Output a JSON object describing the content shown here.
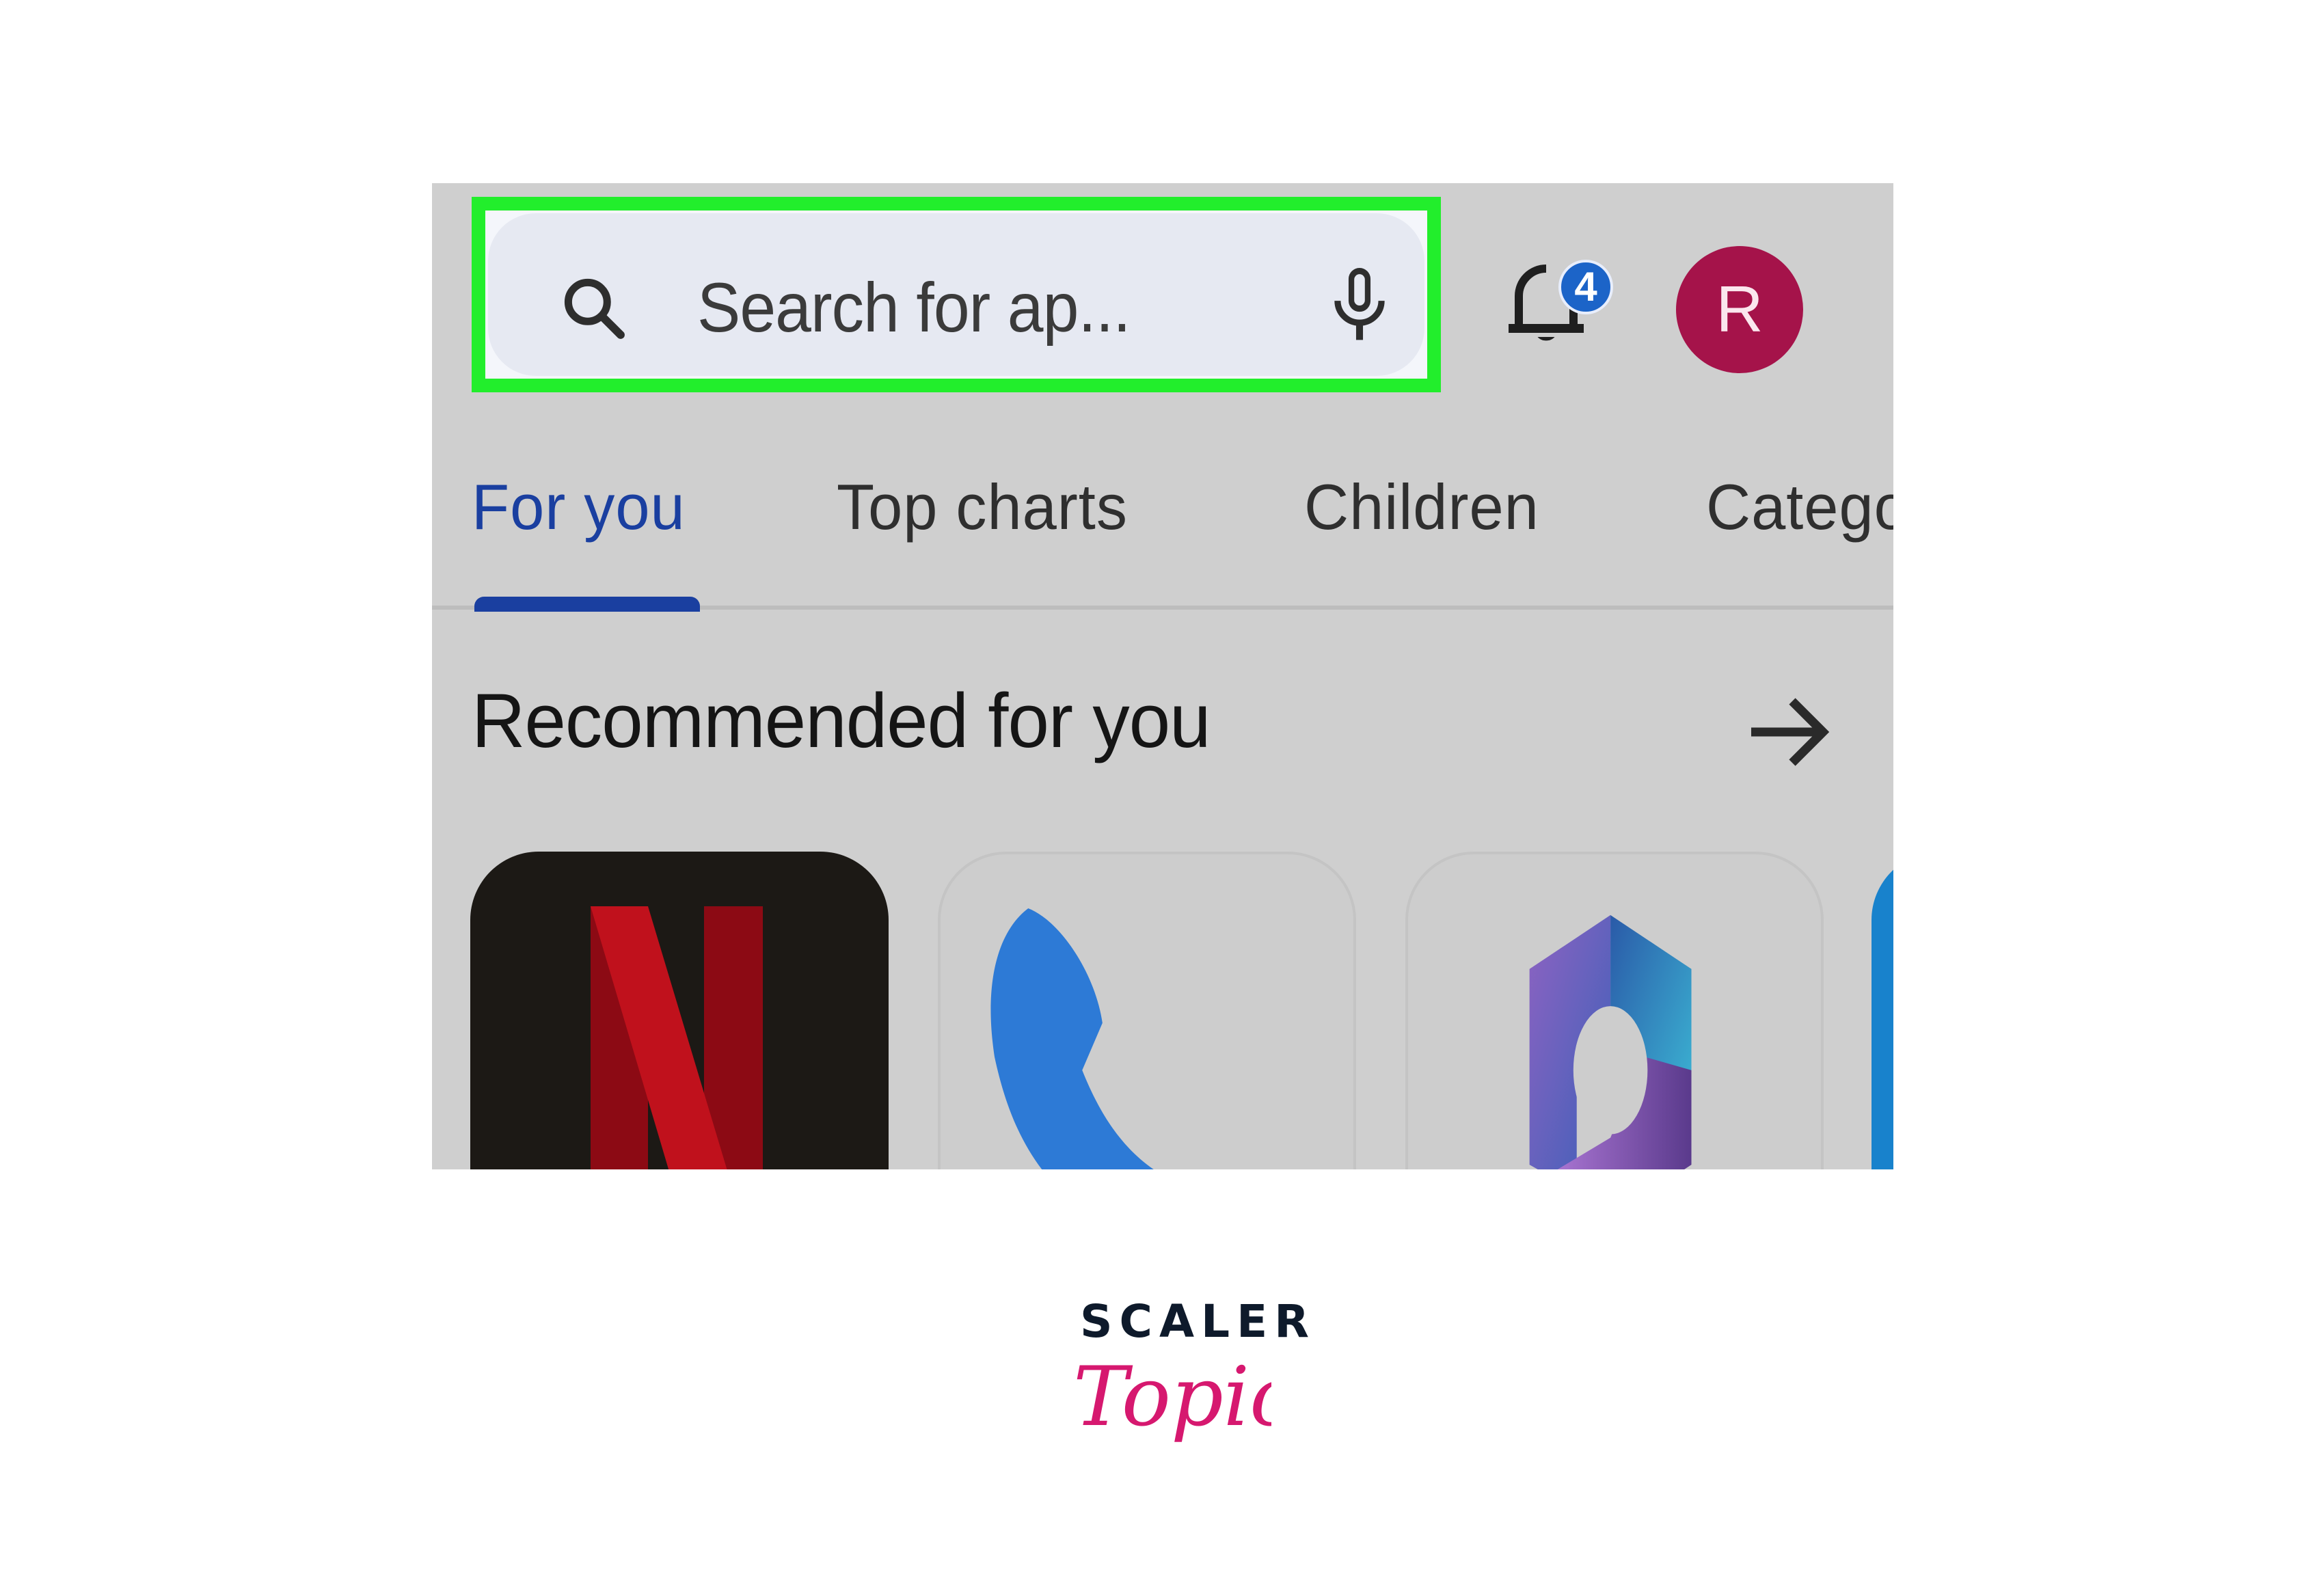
{
  "search": {
    "placeholder": "Search for ap...",
    "highlight_color": "#22ee2c",
    "left_icon": "search-icon",
    "right_icon": "mic-icon"
  },
  "header": {
    "notifications_icon": "bell-icon",
    "notification_count": "4",
    "badge_color": "#1c64c8",
    "avatar_initial": "R",
    "avatar_color": "#a5134a"
  },
  "tabs": [
    {
      "label": "For you",
      "active": true
    },
    {
      "label": "Top charts",
      "active": false
    },
    {
      "label": "Children",
      "active": false
    },
    {
      "label": "Categories",
      "display": "Catego",
      "active": false
    }
  ],
  "section": {
    "title": "Recommended for you",
    "more_icon": "arrow-right-icon"
  },
  "apps": [
    {
      "name": "Netflix",
      "icon": "netflix-icon"
    },
    {
      "name": "Phone",
      "icon": "phone-icon"
    },
    {
      "name": "Microsoft 365 (Office)",
      "icon": "office-icon"
    },
    {
      "name": "partially visible app",
      "icon": "app-icon"
    }
  ],
  "brand": {
    "line1": "SCALER",
    "line2": "Topics",
    "line2_color": "#d6186f"
  }
}
